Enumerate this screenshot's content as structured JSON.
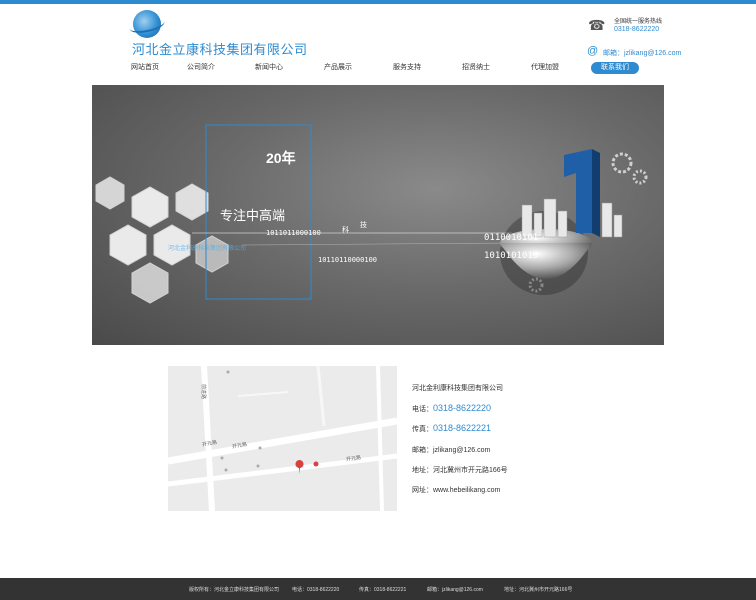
{
  "header": {
    "company_name": "河北金立康科技集团有限公司",
    "hotline_label": "全国统一服务热线",
    "hotline_number": "0318-8622220",
    "email_text": "邮箱：jzlikang@126.com"
  },
  "nav": {
    "items": [
      {
        "label": "网站首页"
      },
      {
        "label": "公司简介"
      },
      {
        "label": "新闻中心"
      },
      {
        "label": "产品展示"
      },
      {
        "label": "服务支持"
      },
      {
        "label": "招贤纳士"
      },
      {
        "label": "代理加盟"
      },
      {
        "label": "联系我们"
      }
    ]
  },
  "banner": {
    "year": "20年",
    "slogan": "专注中高端",
    "binary1": "1011011000100",
    "binary2": "10110110000100",
    "tech1": "科",
    "tech2": "技",
    "bin_right1": "0110010101",
    "bin_right2": "1010101010",
    "blue_text": "河北金利康科技集团有限公司"
  },
  "map": {
    "labels": [
      "开元路",
      "开元路",
      "开元路",
      "前进路"
    ]
  },
  "contact": {
    "company": "河北金利康科技集团有限公司",
    "phone_label": "电话：",
    "phone": "0318-8622220",
    "fax_label": "传真：",
    "fax": "0318-8622221",
    "email": "邮箱：jzlikang@126.com",
    "address": "地址：河北冀州市开元路166号",
    "website": "网址：www.hebeilikang.com"
  },
  "footer": {
    "copyright": "版权所有：河北金立康科技集团有限公司",
    "phone": "电话：0318-8622220",
    "fax": "传真：0318-8622221",
    "email": "邮箱：jzlikang@126.com",
    "address": "地址：河北冀州市开元路166号"
  }
}
